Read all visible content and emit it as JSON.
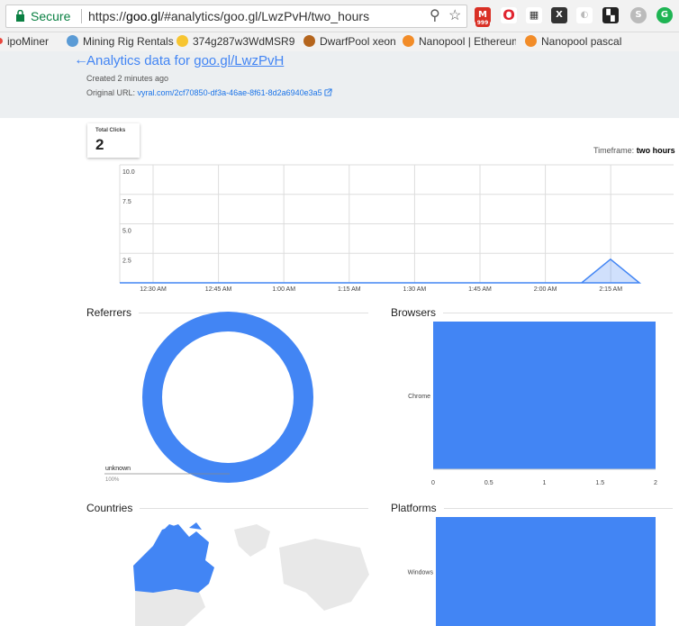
{
  "browser": {
    "secure_label": "Secure",
    "url_prefix": "https://",
    "url_host": "goo.gl",
    "url_path": "/#analytics/goo.gl/LwzPvH/two_hours",
    "mail_badge": "999"
  },
  "bookmarks": [
    {
      "label": "ipoMiner",
      "color": "#e8453c"
    },
    {
      "label": "Mining Rig Rentals",
      "color": "#5b9bd5"
    },
    {
      "label": "374g287w3WdMSR9",
      "color": "#f7c531"
    },
    {
      "label": "DwarfPool xeon",
      "color": "#b5651d"
    },
    {
      "label": "Nanopool | Ethereum",
      "color": "#f28c28"
    },
    {
      "label": "Nanopool pascal",
      "color": "#f28c28"
    }
  ],
  "header": {
    "back_glyph": "←",
    "title_prefix": "Analytics data for ",
    "title_link": "goo.gl/LwzPvH",
    "created": "Created 2 minutes ago",
    "original_label": "Original URL: ",
    "original_url": "vyral.com/2cf70850-df3a-46ae-8f61-8d2a6940e3a5"
  },
  "total_clicks": {
    "label": "Total Clicks",
    "value": "2"
  },
  "timeframe": {
    "label": "Timeframe:",
    "value": "two hours"
  },
  "sections": {
    "referrers": "Referrers",
    "browsers": "Browsers",
    "countries": "Countries",
    "platforms": "Platforms"
  },
  "colors": {
    "accent": "#4285f4",
    "header_bg": "#eceff1"
  },
  "chart_data": [
    {
      "type": "area",
      "title": "",
      "x": [
        "12:30 AM",
        "12:45 AM",
        "1:00 AM",
        "1:15 AM",
        "1:30 AM",
        "1:45 AM",
        "2:00 AM",
        "2:15 AM"
      ],
      "series": [
        {
          "values": [
            0,
            0,
            0,
            0,
            0,
            0,
            0,
            0,
            0,
            0,
            0,
            0,
            0,
            0,
            0,
            0,
            0,
            2,
            0
          ]
        }
      ],
      "y_ticks": [
        "10.0",
        "7.5",
        "5.0",
        "2.5"
      ],
      "ylim": [
        0,
        10
      ],
      "grid": true
    },
    {
      "type": "pie",
      "donut": true,
      "slices": [
        {
          "label": "unknown",
          "value": 100,
          "percent_label": "100%"
        }
      ]
    },
    {
      "type": "bar",
      "orientation": "horizontal",
      "categories": [
        "Chrome"
      ],
      "values": [
        2
      ],
      "x_ticks": [
        "0",
        "0.5",
        "1",
        "1.5",
        "2"
      ],
      "xlim": [
        0,
        2
      ]
    },
    {
      "type": "bar",
      "orientation": "horizontal",
      "categories": [
        "Windows"
      ],
      "values": [
        2
      ],
      "xlim": [
        0,
        2
      ]
    }
  ]
}
